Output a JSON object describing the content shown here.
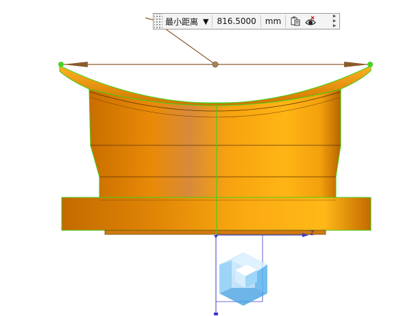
{
  "measurement_toolbar": {
    "measure_type": "最小距离",
    "dropdown_glyph": "▼",
    "value": "816.5000",
    "unit": "mm",
    "icons": [
      "copy-to-clipboard-icon",
      "visibility-icon"
    ],
    "overflow_icon": "toolbar-overflow-icon"
  },
  "triad": {
    "z_axis_label": "Z"
  },
  "colors": {
    "part_orange": "#f29a0c",
    "edge_green": "#3fd21a",
    "dimension_brown": "#8b5a2b",
    "triad_blue": "#3a3ac8",
    "cube_blue": "#5ab8f0"
  }
}
